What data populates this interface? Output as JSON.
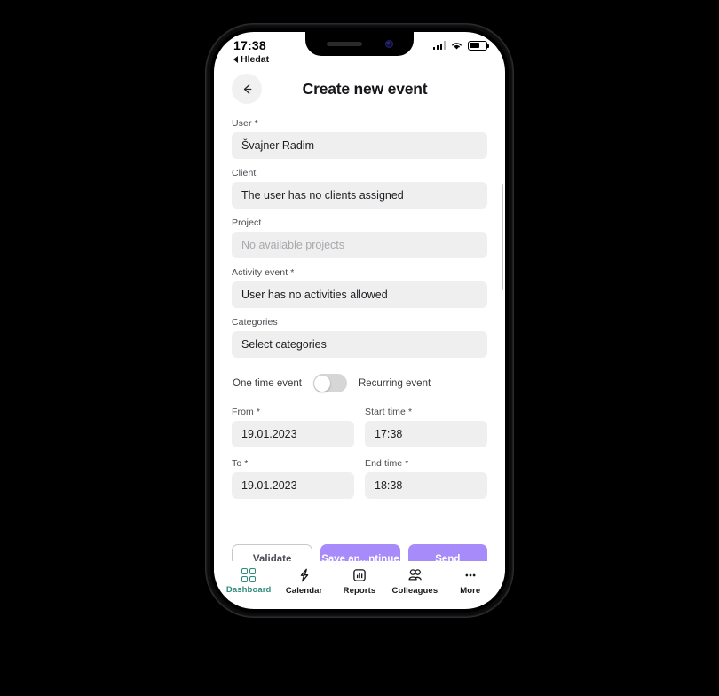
{
  "status_bar": {
    "time": "17:38",
    "signal_icon": "cellular-signal-icon",
    "wifi_icon": "wifi-icon",
    "battery_icon": "battery-icon"
  },
  "back_to_app": {
    "label": "Hledat",
    "icon": "back-triangle-icon"
  },
  "header": {
    "title": "Create new event",
    "back_icon": "arrow-left-icon"
  },
  "form": {
    "fields": [
      {
        "label": "User *",
        "value": "Švajner Radim",
        "is_placeholder": false
      },
      {
        "label": "Client",
        "value": "The user has no clients assigned",
        "is_placeholder": false
      },
      {
        "label": "Project",
        "value": "No available projects",
        "is_placeholder": true
      },
      {
        "label": "Activity event *",
        "value": "User has no activities allowed",
        "is_placeholder": false
      },
      {
        "label": "Categories",
        "value": "Select categories",
        "is_placeholder": false
      }
    ],
    "toggle": {
      "left_label": "One time event",
      "right_label": "Recurring event",
      "state": "off"
    },
    "date_fields": [
      {
        "label": "From *",
        "value": "19.01.2023"
      },
      {
        "label": "Start time *",
        "value": "17:38"
      },
      {
        "label": "To *",
        "value": "19.01.2023"
      },
      {
        "label": "End time *",
        "value": "18:38"
      }
    ]
  },
  "actions": {
    "validate_label": "Validate",
    "save_continue_label": "Save an...ntinue",
    "send_label": "Send"
  },
  "tab_bar": {
    "items": [
      {
        "label": "Dashboard",
        "icon": "grid-icon",
        "active": true
      },
      {
        "label": "Calendar",
        "icon": "lightning-icon",
        "active": false
      },
      {
        "label": "Reports",
        "icon": "bar-chart-icon",
        "active": false
      },
      {
        "label": "Colleagues",
        "icon": "people-icon",
        "active": false
      },
      {
        "label": "More",
        "icon": "ellipsis-icon",
        "active": false
      }
    ]
  },
  "colors": {
    "accent_purple": "#a78bfa",
    "accent_teal": "#2e8b7a",
    "field_background": "#efefef",
    "screen_background": "#ffffff"
  }
}
